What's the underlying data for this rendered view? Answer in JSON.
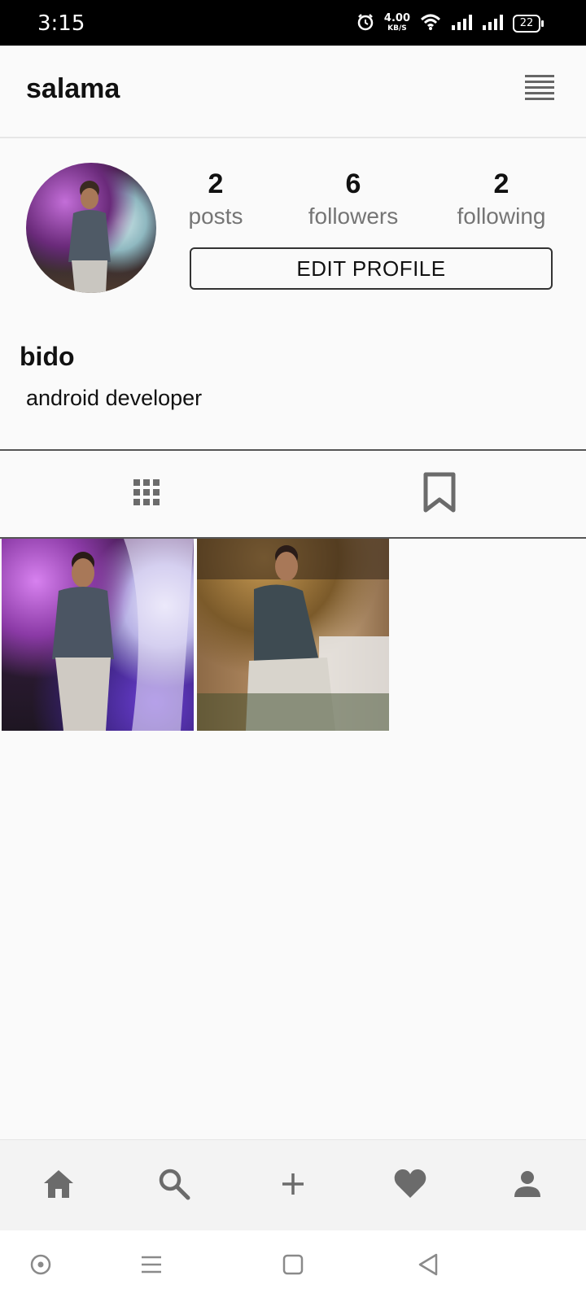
{
  "status_bar": {
    "time": "3:15",
    "net_speed": "4.00",
    "net_speed_unit": "KB/S",
    "battery": "22"
  },
  "app_bar": {
    "title": "salama",
    "menu_icon": "menu-lines-icon"
  },
  "profile": {
    "stats": [
      {
        "value": "2",
        "label": "posts"
      },
      {
        "value": "6",
        "label": "followers"
      },
      {
        "value": "2",
        "label": "following"
      }
    ],
    "edit_button": "EDIT PROFILE",
    "display_name": "bido",
    "bio": "android developer"
  },
  "tabs": [
    {
      "icon": "grid-icon",
      "selected": true
    },
    {
      "icon": "bookmark-icon",
      "selected": false
    }
  ],
  "posts_count": 2,
  "bottom_nav": [
    "home-icon",
    "search-icon",
    "add-icon",
    "heart-icon",
    "person-icon"
  ],
  "colors": {
    "icon_gray": "#6b6b6b",
    "background": "#fafafa",
    "status_bar": "#000000"
  }
}
